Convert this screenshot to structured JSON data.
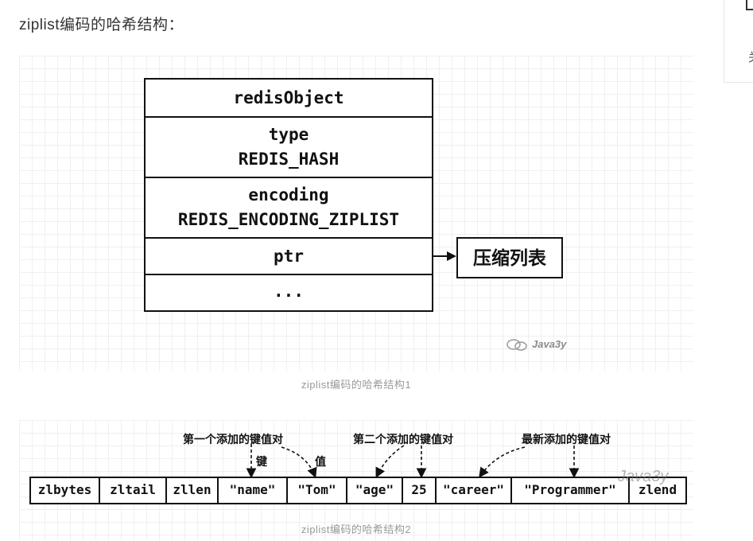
{
  "intro_text": "ziplist编码的哈希结构：",
  "sidebar": {
    "fragment_text": "关"
  },
  "figure1": {
    "redis_object": {
      "title": "redisObject",
      "type_label": "type",
      "type_value": "REDIS_HASH",
      "encoding_label": "encoding",
      "encoding_value": "REDIS_ENCODING_ZIPLIST",
      "ptr_label": "ptr",
      "more_label": "..."
    },
    "target_label": "压缩列表",
    "watermark": "Java3y",
    "caption": "ziplist编码的哈希结构1"
  },
  "figure2": {
    "cells": [
      "zlbytes",
      "zltail",
      "zllen",
      "\"name\"",
      "\"Tom\"",
      "\"age\"",
      "25",
      "\"career\"",
      "\"Programmer\"",
      "zlend"
    ],
    "annotations": {
      "first_pair": "第一个添加的键值对",
      "second_pair": "第二个添加的键值对",
      "latest_pair": "最新添加的键值对",
      "key": "键",
      "value": "值"
    },
    "watermark": "Java3y",
    "caption": "ziplist编码的哈希结构2"
  }
}
